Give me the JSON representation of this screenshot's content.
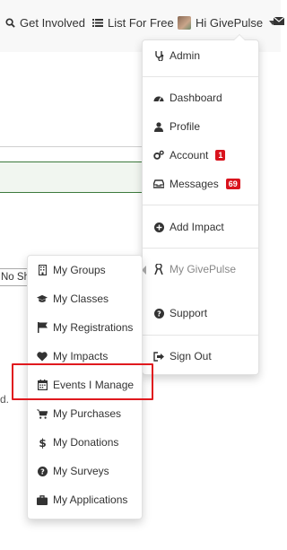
{
  "topnav": {
    "get_involved": "Get Involved",
    "list_for_free": "List For Free",
    "user_greeting": "Hi GivePulse"
  },
  "background": {
    "select_fragment": "No Sh",
    "text_fragment": "d."
  },
  "user_menu": {
    "admin": "Admin",
    "dashboard": "Dashboard",
    "profile": "Profile",
    "account": "Account",
    "account_badge": "1",
    "messages": "Messages",
    "messages_badge": "69",
    "add_impact": "Add Impact",
    "my_givepulse": "My GivePulse",
    "support": "Support",
    "sign_out": "Sign Out"
  },
  "submenu": {
    "items": [
      {
        "label": "My Groups",
        "icon": "building-icon"
      },
      {
        "label": "My Classes",
        "icon": "graduation-cap-icon"
      },
      {
        "label": "My Registrations",
        "icon": "flag-icon"
      },
      {
        "label": "My Impacts",
        "icon": "heart-icon"
      },
      {
        "label": "Events I Manage",
        "icon": "calendar-icon"
      },
      {
        "label": "My Purchases",
        "icon": "cart-icon"
      },
      {
        "label": "My Donations",
        "icon": "dollar-icon"
      },
      {
        "label": "My Surveys",
        "icon": "question-circle-icon"
      },
      {
        "label": "My Applications",
        "icon": "briefcase-icon"
      }
    ]
  },
  "colors": {
    "badge_red": "#d9131d",
    "highlight_red": "#e0191e",
    "green_border": "#3c7a3c"
  }
}
